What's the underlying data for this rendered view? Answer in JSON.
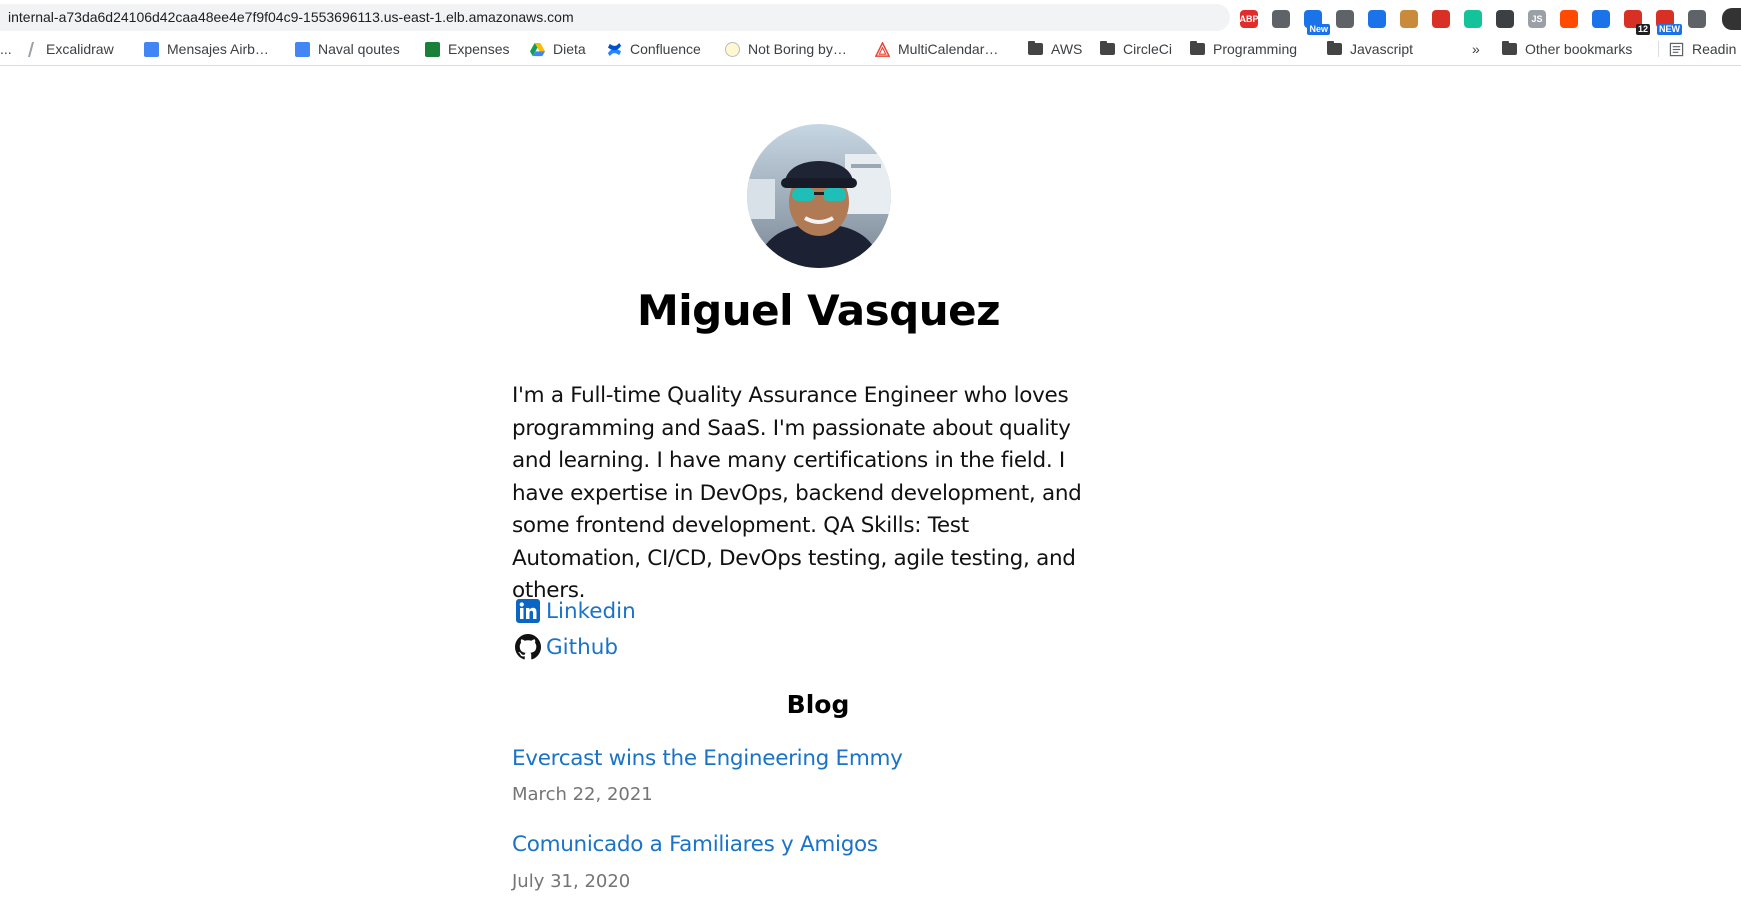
{
  "browser": {
    "url": "internal-a73da6d24106d42caa48ee4e7f9f04c9-1553696113.us-east-1.elb.amazonaws.com",
    "extensions": [
      {
        "name": "adblock-plus-icon",
        "label": "ABP",
        "color": "#e22b2b"
      },
      {
        "name": "umbrella-icon",
        "label": "",
        "color": "#5f6368"
      },
      {
        "name": "news-extension-icon",
        "label": "",
        "color": "#1a73e8",
        "badge": "New",
        "badge_color": "#1a73e8"
      },
      {
        "name": "checkmark-circle-icon",
        "label": "",
        "color": "#5f6368"
      },
      {
        "name": "download-icon",
        "label": "",
        "color": "#1a73e8"
      },
      {
        "name": "cookie-icon",
        "label": "",
        "color": "#c98a3a"
      },
      {
        "name": "red-dots-icon",
        "label": "",
        "color": "#d93025"
      },
      {
        "name": "grammarly-icon",
        "label": "",
        "color": "#15c39a"
      },
      {
        "name": "refresh-icon",
        "label": "",
        "color": "#3c4043"
      },
      {
        "name": "js-icon",
        "label": "JS",
        "color": "#9aa0a6"
      },
      {
        "name": "zapier-icon",
        "label": "",
        "color": "#ff4a00"
      },
      {
        "name": "picture-in-picture-icon",
        "label": "",
        "color": "#1a73e8"
      },
      {
        "name": "calendar-extension-icon",
        "label": "",
        "color": "#d93025",
        "badge": "12",
        "badge_color": "#202124"
      },
      {
        "name": "mail-extension-icon",
        "label": "",
        "color": "#d93025",
        "badge": "NEW",
        "badge_color": "#1a73e8"
      },
      {
        "name": "puzzle-icon",
        "label": "",
        "color": "#5f6368"
      }
    ],
    "bookmarks": [
      {
        "label": "...",
        "icon": "truncated"
      },
      {
        "label": "Excalidraw",
        "icon": "excalidraw-icon"
      },
      {
        "label": "Mensajes Airb…",
        "icon": "google-doc-icon"
      },
      {
        "label": "Naval qoutes",
        "icon": "google-doc-icon"
      },
      {
        "label": "Expenses",
        "icon": "google-sheet-icon"
      },
      {
        "label": "Dieta",
        "icon": "google-drive-icon"
      },
      {
        "label": "Confluence",
        "icon": "confluence-icon"
      },
      {
        "label": "Not Boring by…",
        "icon": "not-boring-icon"
      },
      {
        "label": "MultiCalendar…",
        "icon": "multicalendar-icon"
      },
      {
        "label": "AWS",
        "icon": "folder-icon"
      },
      {
        "label": "CircleCi",
        "icon": "folder-icon"
      },
      {
        "label": "Programming",
        "icon": "folder-icon"
      },
      {
        "label": "Javascript",
        "icon": "folder-icon"
      }
    ],
    "overflow_chevron": "»",
    "other_bookmarks": "Other bookmarks",
    "reading_list": "Readin"
  },
  "profile": {
    "name": "Miguel Vasquez",
    "bio": "I'm a Full-time Quality Assurance Engineer who loves programming and SaaS. I'm passionate about quality and learning. I have many certifications in the field. I have expertise in DevOps, backend development, and some frontend development. QA Skills: Test Automation, CI/CD, DevOps testing, agile testing, and others.",
    "links": [
      {
        "label": "Linkedin",
        "icon": "linkedin-icon",
        "color": "#0a66c2"
      },
      {
        "label": "Github",
        "icon": "github-icon",
        "color": "#111111"
      }
    ]
  },
  "blog": {
    "title": "Blog",
    "posts": [
      {
        "title": "Evercast wins the Engineering Emmy",
        "date": "March 22, 2021"
      },
      {
        "title": "Comunicado a Familiares y Amigos",
        "date": "July 31, 2020"
      }
    ]
  },
  "colors": {
    "link": "#1a73c8",
    "date": "#757575",
    "text": "#111111"
  }
}
